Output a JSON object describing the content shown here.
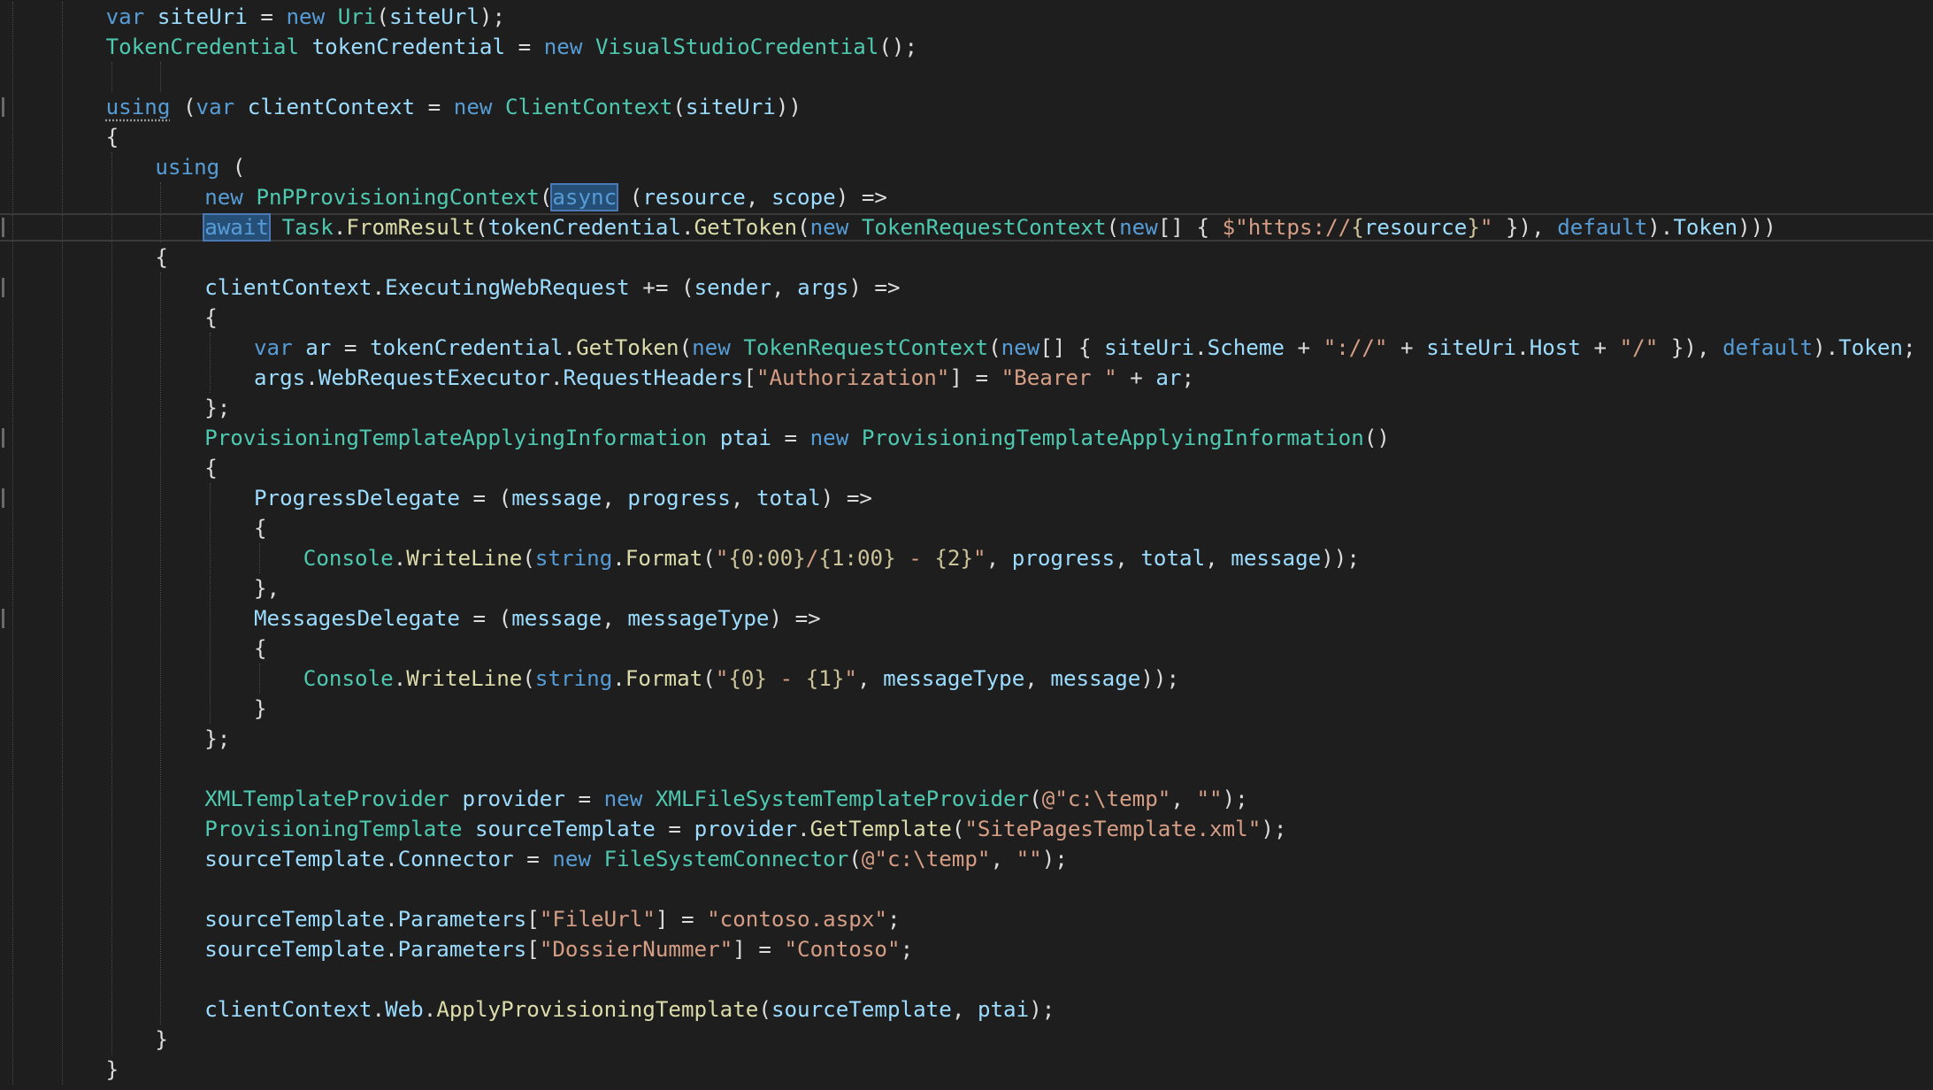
{
  "editor": {
    "theme": "dark",
    "colors": {
      "background": "#1e1e1e",
      "plain": "#dcdcdc",
      "variable": "#9cdcfe",
      "keyword": "#569cd6",
      "type": "#4ec9b0",
      "method": "#dcdcaa",
      "string": "#d69d85",
      "selection": "#264f78"
    },
    "current_line_number": 8,
    "highlighted_words": [
      "async",
      "await"
    ],
    "lines": [
      {
        "indent": 2,
        "tokens": [
          [
            "kw",
            "var"
          ],
          [
            "plain",
            " "
          ],
          [
            "var",
            "siteUri"
          ],
          [
            "plain",
            " = "
          ],
          [
            "kw",
            "new"
          ],
          [
            "plain",
            " "
          ],
          [
            "type",
            "Uri"
          ],
          [
            "plain",
            "("
          ],
          [
            "var",
            "siteUrl"
          ],
          [
            "plain",
            ");"
          ]
        ]
      },
      {
        "indent": 2,
        "tokens": [
          [
            "type",
            "TokenCredential"
          ],
          [
            "plain",
            " "
          ],
          [
            "var",
            "tokenCredential"
          ],
          [
            "plain",
            " = "
          ],
          [
            "kw",
            "new"
          ],
          [
            "plain",
            " "
          ],
          [
            "type",
            "VisualStudioCredential"
          ],
          [
            "plain",
            "();"
          ]
        ]
      },
      {
        "indent": 2,
        "tokens": []
      },
      {
        "indent": 2,
        "tokens": [
          [
            "kw-dots",
            "using"
          ],
          [
            "plain",
            " ("
          ],
          [
            "kw",
            "var"
          ],
          [
            "plain",
            " "
          ],
          [
            "var",
            "clientContext"
          ],
          [
            "plain",
            " = "
          ],
          [
            "kw",
            "new"
          ],
          [
            "plain",
            " "
          ],
          [
            "type",
            "ClientContext"
          ],
          [
            "plain",
            "("
          ],
          [
            "var",
            "siteUri"
          ],
          [
            "plain",
            "))"
          ]
        ]
      },
      {
        "indent": 2,
        "tokens": [
          [
            "plain",
            "{"
          ]
        ]
      },
      {
        "indent": 3,
        "tokens": [
          [
            "kw",
            "using"
          ],
          [
            "plain",
            " ("
          ]
        ]
      },
      {
        "indent": 4,
        "tokens": [
          [
            "kw",
            "new"
          ],
          [
            "plain",
            " "
          ],
          [
            "type",
            "PnPProvisioningContext"
          ],
          [
            "plain",
            "("
          ],
          [
            "kw-hl",
            "async"
          ],
          [
            "plain",
            " ("
          ],
          [
            "var",
            "resource"
          ],
          [
            "plain",
            ", "
          ],
          [
            "var",
            "scope"
          ],
          [
            "plain",
            ") =>"
          ]
        ]
      },
      {
        "indent": 4,
        "tokens": [
          [
            "kw-hl",
            "await"
          ],
          [
            "plain",
            " "
          ],
          [
            "type",
            "Task"
          ],
          [
            "plain",
            "."
          ],
          [
            "method",
            "FromResult"
          ],
          [
            "plain",
            "("
          ],
          [
            "var",
            "tokenCredential"
          ],
          [
            "plain",
            "."
          ],
          [
            "method",
            "GetToken"
          ],
          [
            "plain",
            "("
          ],
          [
            "kw",
            "new"
          ],
          [
            "plain",
            " "
          ],
          [
            "type",
            "TokenRequestContext"
          ],
          [
            "plain",
            "("
          ],
          [
            "kw",
            "new"
          ],
          [
            "plain",
            "[] { "
          ],
          [
            "str",
            "$\"https://"
          ],
          [
            "strbrace",
            "{"
          ],
          [
            "var",
            "resource"
          ],
          [
            "strbrace",
            "}"
          ],
          [
            "str",
            "\""
          ],
          [
            "plain",
            " }), "
          ],
          [
            "kw",
            "default"
          ],
          [
            "plain",
            ")."
          ],
          [
            "var",
            "Token"
          ],
          [
            "plain",
            ")))"
          ]
        ]
      },
      {
        "indent": 3,
        "tokens": [
          [
            "plain",
            "{"
          ]
        ]
      },
      {
        "indent": 4,
        "tokens": [
          [
            "var",
            "clientContext"
          ],
          [
            "plain",
            "."
          ],
          [
            "var",
            "ExecutingWebRequest"
          ],
          [
            "plain",
            " += ("
          ],
          [
            "var",
            "sender"
          ],
          [
            "plain",
            ", "
          ],
          [
            "var",
            "args"
          ],
          [
            "plain",
            ") =>"
          ]
        ]
      },
      {
        "indent": 4,
        "tokens": [
          [
            "plain",
            "{"
          ]
        ]
      },
      {
        "indent": 5,
        "tokens": [
          [
            "kw",
            "var"
          ],
          [
            "plain",
            " "
          ],
          [
            "var",
            "ar"
          ],
          [
            "plain",
            " = "
          ],
          [
            "var",
            "tokenCredential"
          ],
          [
            "plain",
            "."
          ],
          [
            "method",
            "GetToken"
          ],
          [
            "plain",
            "("
          ],
          [
            "kw",
            "new"
          ],
          [
            "plain",
            " "
          ],
          [
            "type",
            "TokenRequestContext"
          ],
          [
            "plain",
            "("
          ],
          [
            "kw",
            "new"
          ],
          [
            "plain",
            "[] { "
          ],
          [
            "var",
            "siteUri"
          ],
          [
            "plain",
            "."
          ],
          [
            "var",
            "Scheme"
          ],
          [
            "plain",
            " + "
          ],
          [
            "str",
            "\"://\""
          ],
          [
            "plain",
            " + "
          ],
          [
            "var",
            "siteUri"
          ],
          [
            "plain",
            "."
          ],
          [
            "var",
            "Host"
          ],
          [
            "plain",
            " + "
          ],
          [
            "str",
            "\"/\""
          ],
          [
            "plain",
            " }), "
          ],
          [
            "kw",
            "default"
          ],
          [
            "plain",
            ")."
          ],
          [
            "var",
            "Token"
          ],
          [
            "plain",
            ";"
          ]
        ]
      },
      {
        "indent": 5,
        "tokens": [
          [
            "var",
            "args"
          ],
          [
            "plain",
            "."
          ],
          [
            "var",
            "WebRequestExecutor"
          ],
          [
            "plain",
            "."
          ],
          [
            "var",
            "RequestHeaders"
          ],
          [
            "plain",
            "["
          ],
          [
            "str",
            "\"Authorization\""
          ],
          [
            "plain",
            "] = "
          ],
          [
            "str",
            "\"Bearer \""
          ],
          [
            "plain",
            " + "
          ],
          [
            "var",
            "ar"
          ],
          [
            "plain",
            ";"
          ]
        ]
      },
      {
        "indent": 4,
        "tokens": [
          [
            "plain",
            "};"
          ]
        ]
      },
      {
        "indent": 4,
        "tokens": [
          [
            "type",
            "ProvisioningTemplateApplyingInformation"
          ],
          [
            "plain",
            " "
          ],
          [
            "var",
            "ptai"
          ],
          [
            "plain",
            " = "
          ],
          [
            "kw",
            "new"
          ],
          [
            "plain",
            " "
          ],
          [
            "type",
            "ProvisioningTemplateApplyingInformation"
          ],
          [
            "plain",
            "()"
          ]
        ]
      },
      {
        "indent": 4,
        "tokens": [
          [
            "plain",
            "{"
          ]
        ]
      },
      {
        "indent": 5,
        "tokens": [
          [
            "var",
            "ProgressDelegate"
          ],
          [
            "plain",
            " = ("
          ],
          [
            "var",
            "message"
          ],
          [
            "plain",
            ", "
          ],
          [
            "var",
            "progress"
          ],
          [
            "plain",
            ", "
          ],
          [
            "var",
            "total"
          ],
          [
            "plain",
            ") =>"
          ]
        ]
      },
      {
        "indent": 5,
        "tokens": [
          [
            "plain",
            "{"
          ]
        ]
      },
      {
        "indent": 6,
        "tokens": [
          [
            "type",
            "Console"
          ],
          [
            "plain",
            "."
          ],
          [
            "method",
            "WriteLine"
          ],
          [
            "plain",
            "("
          ],
          [
            "kw",
            "string"
          ],
          [
            "plain",
            "."
          ],
          [
            "method",
            "Format"
          ],
          [
            "plain",
            "("
          ],
          [
            "str",
            "\""
          ],
          [
            "strbrace",
            "{0:00}"
          ],
          [
            "str",
            "/"
          ],
          [
            "strbrace",
            "{1:00}"
          ],
          [
            "str",
            " - "
          ],
          [
            "strbrace",
            "{2}"
          ],
          [
            "str",
            "\""
          ],
          [
            "plain",
            ", "
          ],
          [
            "var",
            "progress"
          ],
          [
            "plain",
            ", "
          ],
          [
            "var",
            "total"
          ],
          [
            "plain",
            ", "
          ],
          [
            "var",
            "message"
          ],
          [
            "plain",
            "));"
          ]
        ]
      },
      {
        "indent": 5,
        "tokens": [
          [
            "plain",
            "},"
          ]
        ]
      },
      {
        "indent": 5,
        "tokens": [
          [
            "var",
            "MessagesDelegate"
          ],
          [
            "plain",
            " = ("
          ],
          [
            "var",
            "message"
          ],
          [
            "plain",
            ", "
          ],
          [
            "var",
            "messageType"
          ],
          [
            "plain",
            ") =>"
          ]
        ]
      },
      {
        "indent": 5,
        "tokens": [
          [
            "plain",
            "{"
          ]
        ]
      },
      {
        "indent": 6,
        "tokens": [
          [
            "type",
            "Console"
          ],
          [
            "plain",
            "."
          ],
          [
            "method",
            "WriteLine"
          ],
          [
            "plain",
            "("
          ],
          [
            "kw",
            "string"
          ],
          [
            "plain",
            "."
          ],
          [
            "method",
            "Format"
          ],
          [
            "plain",
            "("
          ],
          [
            "str",
            "\""
          ],
          [
            "strbrace",
            "{0}"
          ],
          [
            "str",
            " - "
          ],
          [
            "strbrace",
            "{1}"
          ],
          [
            "str",
            "\""
          ],
          [
            "plain",
            ", "
          ],
          [
            "var",
            "messageType"
          ],
          [
            "plain",
            ", "
          ],
          [
            "var",
            "message"
          ],
          [
            "plain",
            "));"
          ]
        ]
      },
      {
        "indent": 5,
        "tokens": [
          [
            "plain",
            "}"
          ]
        ]
      },
      {
        "indent": 4,
        "tokens": [
          [
            "plain",
            "};"
          ]
        ]
      },
      {
        "indent": 4,
        "tokens": []
      },
      {
        "indent": 4,
        "tokens": [
          [
            "type",
            "XMLTemplateProvider"
          ],
          [
            "plain",
            " "
          ],
          [
            "var",
            "provider"
          ],
          [
            "plain",
            " = "
          ],
          [
            "kw",
            "new"
          ],
          [
            "plain",
            " "
          ],
          [
            "type",
            "XMLFileSystemTemplateProvider"
          ],
          [
            "plain",
            "("
          ],
          [
            "str",
            "@\"c:\\temp\""
          ],
          [
            "plain",
            ", "
          ],
          [
            "str",
            "\"\""
          ],
          [
            "plain",
            ");"
          ]
        ]
      },
      {
        "indent": 4,
        "tokens": [
          [
            "type",
            "ProvisioningTemplate"
          ],
          [
            "plain",
            " "
          ],
          [
            "var",
            "sourceTemplate"
          ],
          [
            "plain",
            " = "
          ],
          [
            "var",
            "provider"
          ],
          [
            "plain",
            "."
          ],
          [
            "method",
            "GetTemplate"
          ],
          [
            "plain",
            "("
          ],
          [
            "str",
            "\"SitePagesTemplate.xml\""
          ],
          [
            "plain",
            ");"
          ]
        ]
      },
      {
        "indent": 4,
        "tokens": [
          [
            "var",
            "sourceTemplate"
          ],
          [
            "plain",
            "."
          ],
          [
            "var",
            "Connector"
          ],
          [
            "plain",
            " = "
          ],
          [
            "kw",
            "new"
          ],
          [
            "plain",
            " "
          ],
          [
            "type",
            "FileSystemConnector"
          ],
          [
            "plain",
            "("
          ],
          [
            "str",
            "@\"c:\\temp\""
          ],
          [
            "plain",
            ", "
          ],
          [
            "str",
            "\"\""
          ],
          [
            "plain",
            ");"
          ]
        ]
      },
      {
        "indent": 4,
        "tokens": []
      },
      {
        "indent": 4,
        "tokens": [
          [
            "var",
            "sourceTemplate"
          ],
          [
            "plain",
            "."
          ],
          [
            "var",
            "Parameters"
          ],
          [
            "plain",
            "["
          ],
          [
            "str",
            "\"FileUrl\""
          ],
          [
            "plain",
            "] = "
          ],
          [
            "str",
            "\"contoso.aspx\""
          ],
          [
            "plain",
            ";"
          ]
        ]
      },
      {
        "indent": 4,
        "tokens": [
          [
            "var",
            "sourceTemplate"
          ],
          [
            "plain",
            "."
          ],
          [
            "var",
            "Parameters"
          ],
          [
            "plain",
            "["
          ],
          [
            "str",
            "\"DossierNummer\""
          ],
          [
            "plain",
            "] = "
          ],
          [
            "str",
            "\"Contoso\""
          ],
          [
            "plain",
            ";"
          ]
        ]
      },
      {
        "indent": 4,
        "tokens": []
      },
      {
        "indent": 4,
        "tokens": [
          [
            "var",
            "clientContext"
          ],
          [
            "plain",
            "."
          ],
          [
            "var",
            "Web"
          ],
          [
            "plain",
            "."
          ],
          [
            "method",
            "ApplyProvisioningTemplate"
          ],
          [
            "plain",
            "("
          ],
          [
            "var",
            "sourceTemplate"
          ],
          [
            "plain",
            ", "
          ],
          [
            "var",
            "ptai"
          ],
          [
            "plain",
            ");"
          ]
        ]
      },
      {
        "indent": 3,
        "tokens": [
          [
            "plain",
            "}"
          ]
        ]
      },
      {
        "indent": 2,
        "tokens": [
          [
            "plain",
            "}"
          ]
        ]
      }
    ]
  }
}
